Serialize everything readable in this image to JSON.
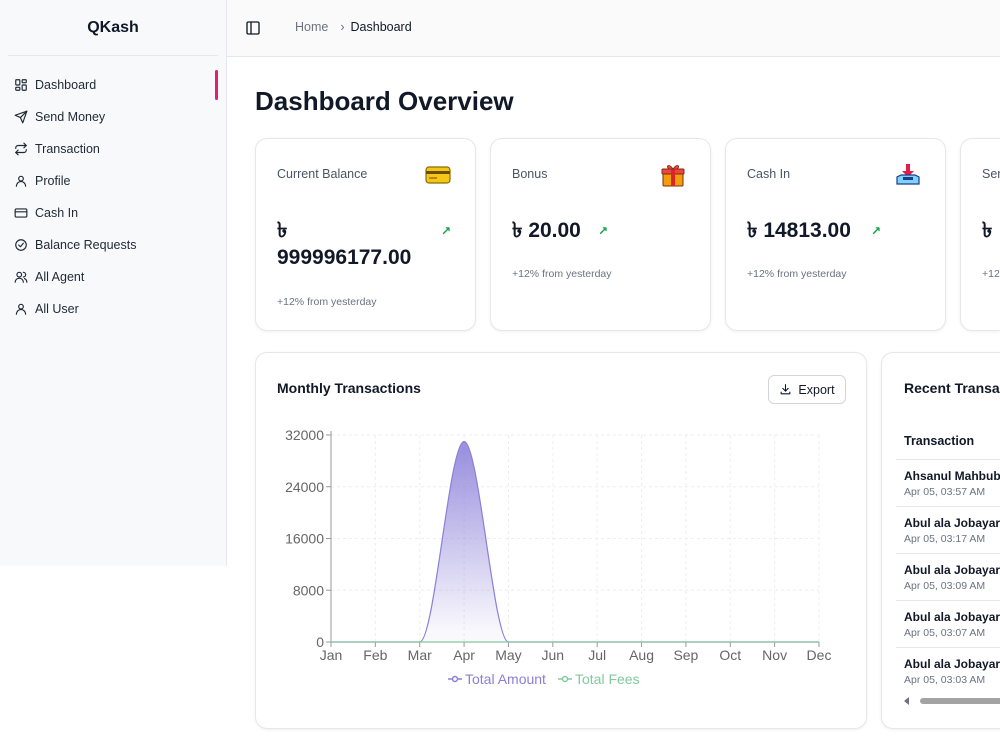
{
  "app": {
    "name": "QKash"
  },
  "sidebar": {
    "items": [
      {
        "label": "Dashboard",
        "icon": "dashboard-grid-icon",
        "active": true
      },
      {
        "label": "Send Money",
        "icon": "send-icon"
      },
      {
        "label": "Transaction",
        "icon": "arrows-swap-icon"
      },
      {
        "label": "Profile",
        "icon": "user-icon"
      },
      {
        "label": "Cash In",
        "icon": "credit-card-icon"
      },
      {
        "label": "Balance Requests",
        "icon": "check-circle-icon"
      },
      {
        "label": "All Agent",
        "icon": "users-icon"
      },
      {
        "label": "All User",
        "icon": "user-icon"
      }
    ]
  },
  "header": {
    "breadcrumb": {
      "home": "Home",
      "current": "Dashboard"
    }
  },
  "page": {
    "title": "Dashboard Overview"
  },
  "stats": [
    {
      "title": "Current Balance",
      "currency": "৳",
      "amount": "999996177.00",
      "sub": "+12% from yesterday",
      "icon": "credit-card-emoji-icon"
    },
    {
      "title": "Bonus",
      "currency": "৳",
      "amount": "20.00",
      "sub": "+12% from yesterday",
      "icon": "gift-icon"
    },
    {
      "title": "Cash In",
      "currency": "৳",
      "amount": "14813.00",
      "sub": "+12% from yesterday",
      "icon": "inbox-tray-icon"
    },
    {
      "title": "Ser",
      "currency": "৳",
      "sub": "+12"
    }
  ],
  "chart_section": {
    "title": "Monthly Transactions",
    "export_label": "Export"
  },
  "chart_data": {
    "type": "area",
    "categories": [
      "Jan",
      "Feb",
      "Mar",
      "Apr",
      "May",
      "Jun",
      "Jul",
      "Aug",
      "Sep",
      "Oct",
      "Nov",
      "Dec"
    ],
    "series": [
      {
        "name": "Total Amount",
        "values": [
          0,
          0,
          0,
          31000,
          0,
          0,
          0,
          0,
          0,
          0,
          0,
          0
        ],
        "color": "#8b7fd9"
      },
      {
        "name": "Total Fees",
        "values": [
          0,
          0,
          0,
          0,
          0,
          0,
          0,
          0,
          0,
          0,
          0,
          0
        ],
        "color": "#82ca9d"
      }
    ],
    "yticks": [
      0,
      8000,
      16000,
      24000,
      32000
    ],
    "ylim": [
      0,
      32000
    ],
    "grid": true,
    "legend": "bottom"
  },
  "recent": {
    "title": "Recent Transac",
    "column": "Transaction",
    "rows": [
      {
        "name": "Ahsanul Mahbub",
        "time": "Apr 05, 03:57 AM"
      },
      {
        "name": "Abul ala Jobayar",
        "time": "Apr 05, 03:17 AM"
      },
      {
        "name": "Abul ala Jobayar",
        "time": "Apr 05, 03:09 AM"
      },
      {
        "name": "Abul ala Jobayar",
        "time": "Apr 05, 03:07 AM"
      },
      {
        "name": "Abul ala Jobayar",
        "time": "Apr 05, 03:03 AM"
      }
    ]
  }
}
